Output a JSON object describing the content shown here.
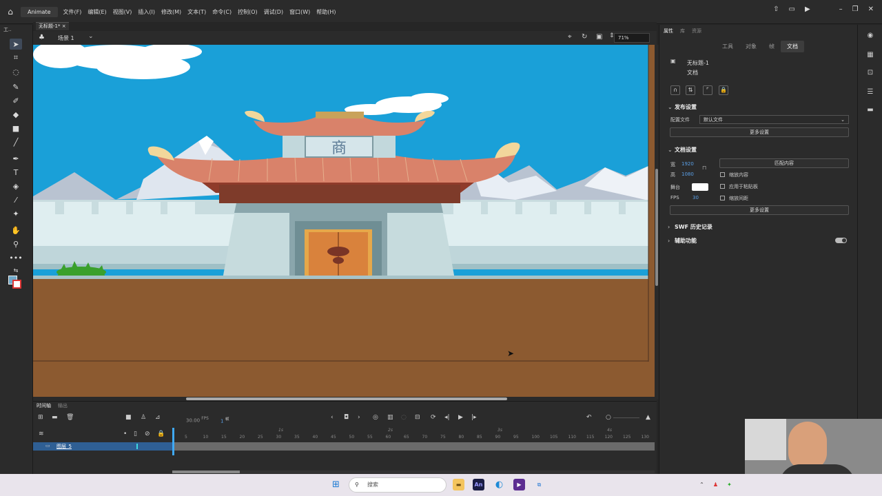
{
  "app": {
    "name": "Animate",
    "menus": [
      "文件(F)",
      "编辑(E)",
      "视图(V)",
      "插入(I)",
      "修改(M)",
      "文本(T)",
      "命令(C)",
      "控制(O)",
      "调试(D)",
      "窗口(W)",
      "帮助(H)"
    ]
  },
  "document": {
    "tab_title": "无标题-1*"
  },
  "toolbar": {
    "label": "工.."
  },
  "scene": {
    "label": "场景 1",
    "zoom": "71%"
  },
  "stage": {
    "sign_text": "商",
    "colors": {
      "sky": "#1aa0d8",
      "ground": "#8c5a30",
      "wall": "#dfeef0",
      "roof": "#d9826a"
    }
  },
  "timeline": {
    "tab_timeline": "时间轴",
    "tab_output": "输出",
    "fps": "30.00",
    "fps_unit": "FPS",
    "frame": "1",
    "frame_unit": "帧",
    "ruler_ticks": [
      "5",
      "10",
      "15",
      "20",
      "25",
      "30",
      "35",
      "40",
      "45",
      "50",
      "55",
      "60",
      "65",
      "70",
      "75",
      "80",
      "85",
      "90",
      "95",
      "100",
      "105",
      "110",
      "115",
      "120",
      "125",
      "130"
    ],
    "ruler_seconds": [
      "1s",
      "2s",
      "3s",
      "4s"
    ],
    "layer_name": "图层_5"
  },
  "properties": {
    "tabs": [
      "属性",
      "库",
      "资源"
    ],
    "subtabs": [
      "工具",
      "对象",
      "帧",
      "文档"
    ],
    "doc_name": "无标题-1",
    "doc_type": "文档",
    "publish": {
      "header": "发布设置",
      "profile_label": "配置文件",
      "profile_value": "默认文件",
      "more_button": "更多设置"
    },
    "doc_settings": {
      "header": "文档设置",
      "width_label": "宽",
      "width_value": "1920",
      "height_label": "高",
      "height_value": "1080",
      "match_button": "匹配内容",
      "scale_content": "缩放内容",
      "stage_label": "舞台",
      "apply_pasteboard": "应用于粘贴板",
      "fps_label": "FPS",
      "fps_value": "30",
      "scale_spacing": "缩放间距",
      "more_button": "更多设置"
    },
    "swf_history": "SWF 历史记录",
    "accessibility": "辅助功能"
  },
  "taskbar": {
    "search_placeholder": "搜索"
  }
}
